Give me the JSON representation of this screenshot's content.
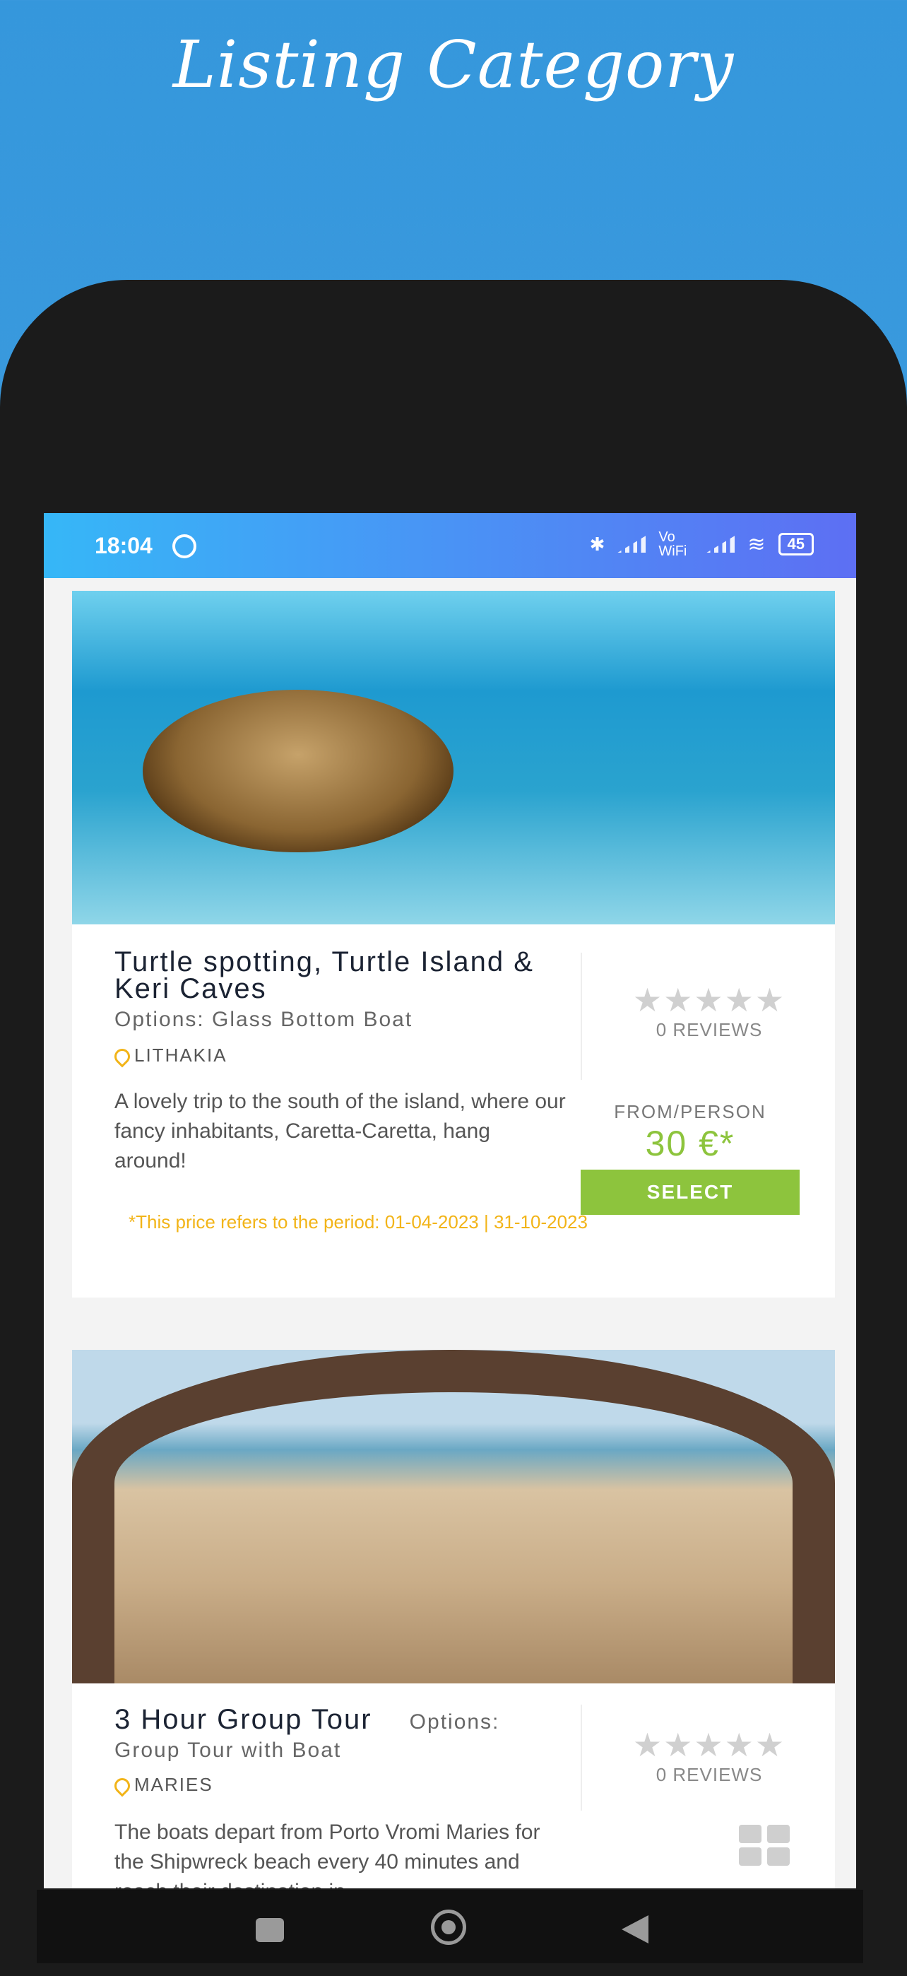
{
  "promo": {
    "title": "Listing Category"
  },
  "status": {
    "time": "18:04",
    "network": "Vo WiFi",
    "battery": "45"
  },
  "listings": [
    {
      "title": "Turtle spotting, Turtle Island & Keri Caves",
      "options": "Options: Glass Bottom Boat",
      "location": "LITHAKIA",
      "rating_stars": "★★★★★",
      "reviews": "0 REVIEWS",
      "description": "A lovely trip to the south of the island, where our fancy inhabitants, Caretta-Caretta, hang around!",
      "price_label": "FROM/PERSON",
      "price": "30 €*",
      "select_label": "SELECT",
      "note": "*This price refers to the period: 01-04-2023 | 31-10-2023"
    },
    {
      "title": "3 Hour Group Tour",
      "options_inline": "Options:",
      "options": "Group Tour with Boat",
      "location": "MARIES",
      "rating_stars": "★★★★★",
      "reviews": "0 REVIEWS",
      "description": "The boats depart from Porto Vromi Maries for the Shipwreck beach every 40 minutes and reach their destination in"
    }
  ],
  "nav": {
    "square": "recent-apps",
    "circle": "home",
    "triangle": "back"
  }
}
